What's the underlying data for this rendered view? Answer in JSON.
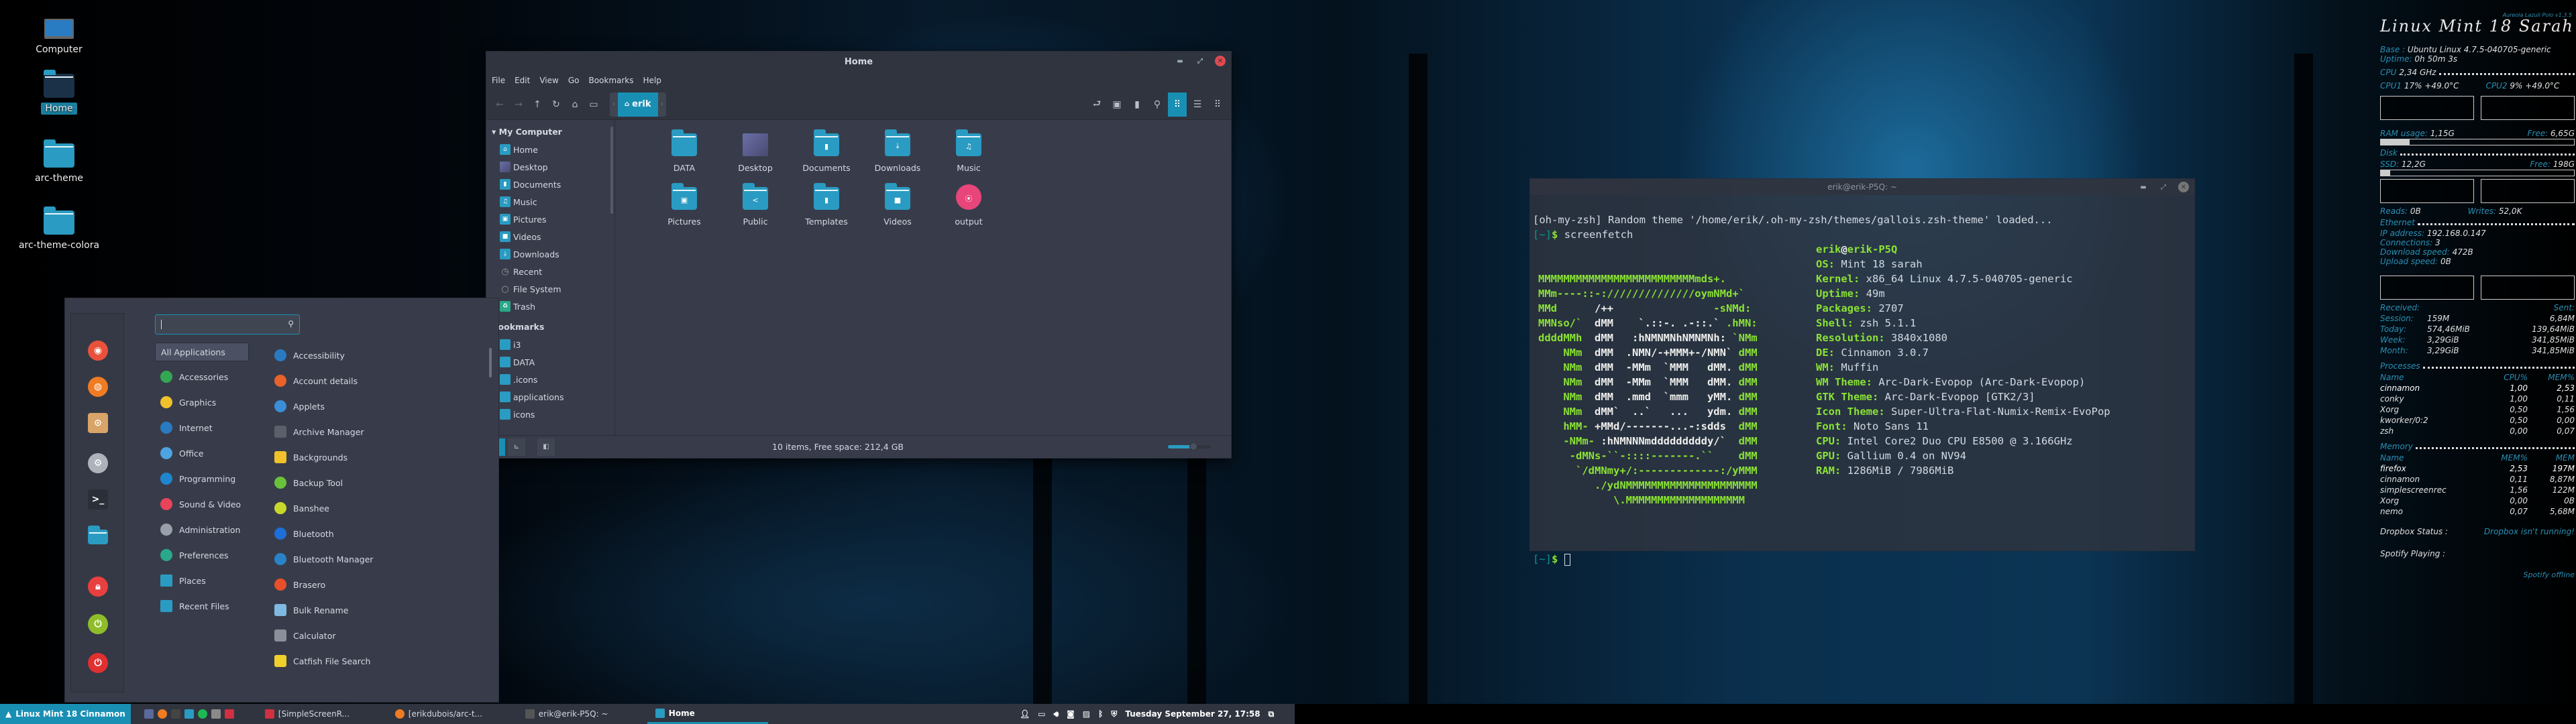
{
  "desktop": {
    "icons": [
      {
        "label": "Computer",
        "icon": "laptop-icon"
      },
      {
        "label": "Home",
        "icon": "home-folder-icon",
        "selected": true
      },
      {
        "label": "arc-theme",
        "icon": "folder-icon"
      },
      {
        "label": "arc-theme-colora",
        "icon": "folder-icon"
      }
    ]
  },
  "file_manager": {
    "title": "Home",
    "menu": [
      "File",
      "Edit",
      "View",
      "Go",
      "Bookmarks",
      "Help"
    ],
    "breadcrumb": {
      "current": "erik",
      "icon": "home-icon"
    },
    "sidebar": {
      "my_computer_header": "My Computer",
      "places": [
        {
          "label": "Home",
          "icon": "home-icon"
        },
        {
          "label": "Desktop",
          "icon": "desktop-icon"
        },
        {
          "label": "Documents",
          "icon": "document-icon"
        },
        {
          "label": "Music",
          "icon": "music-icon"
        },
        {
          "label": "Pictures",
          "icon": "picture-icon"
        },
        {
          "label": "Videos",
          "icon": "video-icon"
        },
        {
          "label": "Downloads",
          "icon": "download-icon"
        },
        {
          "label": "Recent",
          "icon": "clock-icon"
        },
        {
          "label": "File System",
          "icon": "drive-icon"
        },
        {
          "label": "Trash",
          "icon": "trash-icon"
        }
      ],
      "bookmarks_header": "Bookmarks",
      "bookmarks": [
        "i3",
        "DATA",
        ".icons",
        "applications",
        "icons"
      ]
    },
    "items": [
      {
        "label": "DATA",
        "icon": "folder-icon",
        "glyph": ""
      },
      {
        "label": "Desktop",
        "icon": "desktop-icon",
        "glyph": ""
      },
      {
        "label": "Documents",
        "icon": "document-folder-icon",
        "glyph": "▮"
      },
      {
        "label": "Downloads",
        "icon": "download-folder-icon",
        "glyph": "⤓"
      },
      {
        "label": "Music",
        "icon": "music-folder-icon",
        "glyph": "♫"
      },
      {
        "label": "Pictures",
        "icon": "picture-folder-icon",
        "glyph": "▣"
      },
      {
        "label": "Public",
        "icon": "share-folder-icon",
        "glyph": "<"
      },
      {
        "label": "Templates",
        "icon": "template-folder-icon",
        "glyph": "▮"
      },
      {
        "label": "Videos",
        "icon": "video-folder-icon",
        "glyph": "■"
      },
      {
        "label": "output",
        "icon": "film-reel-icon",
        "glyph": ""
      }
    ],
    "status": "10 items, Free space: 212,4 GB",
    "zoom_level_fraction": 0.6
  },
  "app_menu": {
    "search": {
      "value": "",
      "placeholder": ""
    },
    "favorites": [
      {
        "name": "chromium-icon",
        "color": "#e8513a"
      },
      {
        "name": "firefox-icon",
        "color": "#ef7b23"
      },
      {
        "name": "installer-icon",
        "color": "#d9a468"
      },
      {
        "name": "settings-icon",
        "color": "#aeb3bb"
      },
      {
        "name": "terminal-icon",
        "color": "#2b2f38"
      },
      {
        "name": "files-icon",
        "color": "#2a9bc2"
      },
      {
        "name": "lock-icon",
        "color": "#e84040"
      },
      {
        "name": "logout-icon",
        "color": "#8fbd2a"
      },
      {
        "name": "power-icon",
        "color": "#e03030"
      }
    ],
    "categories": [
      {
        "label": "All Applications",
        "selected": true,
        "color": ""
      },
      {
        "label": "Accessories",
        "color": "#33a853"
      },
      {
        "label": "Graphics",
        "color": "#f0c12a"
      },
      {
        "label": "Internet",
        "color": "#2a7ac2"
      },
      {
        "label": "Office",
        "color": "#4ea4e0"
      },
      {
        "label": "Programming",
        "color": "#1e86cf"
      },
      {
        "label": "Sound & Video",
        "color": "#e8435a"
      },
      {
        "label": "Administration",
        "color": "#9aa0aa"
      },
      {
        "label": "Preferences",
        "color": "#2aa88a"
      },
      {
        "label": "Places",
        "color": "#2a9bc2"
      },
      {
        "label": "Recent Files",
        "color": "#2a9bc2"
      }
    ],
    "applications": [
      {
        "label": "Accessibility",
        "color": "#2a7ac2"
      },
      {
        "label": "Account details",
        "color": "#e8622a"
      },
      {
        "label": "Applets",
        "color": "#3a8fd8"
      },
      {
        "label": "Archive Manager",
        "color": "#5a5f6a"
      },
      {
        "label": "Backgrounds",
        "color": "#f0c12a"
      },
      {
        "label": "Backup Tool",
        "color": "#6ac23a"
      },
      {
        "label": "Banshee",
        "color": "#c8d82a"
      },
      {
        "label": "Bluetooth",
        "color": "#1e6fd8"
      },
      {
        "label": "Bluetooth Manager",
        "color": "#2a82c8"
      },
      {
        "label": "Brasero",
        "color": "#e8502a"
      },
      {
        "label": "Bulk Rename",
        "color": "#7fb8e0"
      },
      {
        "label": "Calculator",
        "color": "#8a8f9a"
      },
      {
        "label": "Catfish File Search",
        "color": "#f0d02a"
      }
    ]
  },
  "terminal": {
    "title": "erik@erik-P5Q: ~",
    "theme_line": "[oh-my-zsh] Random theme '/home/erik/.oh-my-zsh/themes/gallois.zsh-theme' loaded...",
    "prompt_dir": "[~]",
    "prompt_symbol": "$",
    "command": "screenfetch",
    "ascii_art": [
      [
        "MMMMMMMMMMMMMMMMMMMMMMMMMmds+.",
        "",
        ""
      ],
      [
        "MMm----::-://////////////oymNMd+`",
        "",
        ""
      ],
      [
        "MMd      ",
        "/++",
        "                -sNMd:"
      ],
      [
        "MMNso/`  ",
        "dMM    `.::-. .-::.`",
        " .hMN:"
      ],
      [
        "ddddMMh  ",
        "dMM   :hNMNMNhNMNMNh:",
        " `NMm"
      ],
      [
        "    NMm  ",
        "dMM  .NMN/-+MMM+-/NMN`",
        " dMM"
      ],
      [
        "    NMm  ",
        "dMM  -MMm  `MMM   dMM.",
        " dMM"
      ],
      [
        "    NMm  ",
        "dMM  -MMm  `MMM   dMM.",
        " dMM"
      ],
      [
        "    NMm  ",
        "dMM  .mmd  `mmm   yMM.",
        " dMM"
      ],
      [
        "    NMm  ",
        "dMM`  ..`   ...   ydm.",
        " dMM"
      ],
      [
        "    hMM- ",
        "+MMd/-------...-:sdds",
        "  dMM"
      ],
      [
        "    -NMm- ",
        ":hNMNNNmdddddddddy/`",
        "  dMM"
      ],
      [
        "     -dMNs-``-::::-------.``",
        "",
        "    dMM"
      ],
      [
        "      `/dMNmy+/:-------------:/yMMM",
        "",
        ""
      ],
      [
        "         ./ydNMMMMMMMMMMMMMMMMMMMMM",
        "",
        ""
      ],
      [
        "            \\.MMMMMMMMMMMMMMMMMMM",
        "",
        ""
      ]
    ],
    "user": "erik",
    "host": "erik-P5Q",
    "info": [
      {
        "key": "OS:",
        "value": "Mint 18 sarah"
      },
      {
        "key": "Kernel:",
        "value": "x86_64 Linux 4.7.5-040705-generic"
      },
      {
        "key": "Uptime:",
        "value": "49m"
      },
      {
        "key": "Packages:",
        "value": "2707"
      },
      {
        "key": "Shell:",
        "value": "zsh 5.1.1"
      },
      {
        "key": "Resolution:",
        "value": "3840x1080"
      },
      {
        "key": "DE:",
        "value": "Cinnamon 3.0.7"
      },
      {
        "key": "WM:",
        "value": "Muffin"
      },
      {
        "key": "WM Theme:",
        "value": "Arc-Dark-Evopop (Arc-Dark-Evopop)"
      },
      {
        "key": "GTK Theme:",
        "value": "Arc-Dark-Evopop [GTK2/3]"
      },
      {
        "key": "Icon Theme:",
        "value": "Super-Ultra-Flat-Numix-Remix-EvoPop"
      },
      {
        "key": "Font:",
        "value": "Noto Sans 11"
      },
      {
        "key": "CPU:",
        "value": "Intel Core2 Duo CPU E8500 @ 3.166GHz"
      },
      {
        "key": "GPU:",
        "value": "Gallium 0.4 on NV94"
      },
      {
        "key": "RAM:",
        "value": "1286MiB / 7986MiB"
      }
    ]
  },
  "conky": {
    "version": "Aureola Lazuli Polo v1.3.5",
    "title": "Linux Mint 18 Sarah",
    "base_label": "Base :",
    "base_value": "Ubuntu Linux 4.7.5-040705-generic",
    "uptime_label": "Uptime:",
    "uptime_value": "0h 50m 3s",
    "cpu_label": "CPU",
    "cpu_freq": "2,34 GHz",
    "cpu1": {
      "label": "CPU1",
      "usage": "17%",
      "temp": "+49.0°C"
    },
    "cpu2": {
      "label": "CPU2",
      "usage": "9%",
      "temp": "+49.0°C"
    },
    "ram_label": "RAM usage:",
    "ram_value": "1,15G",
    "ram_free_label": "Free:",
    "ram_free": "6,65G",
    "ram_fraction": 0.15,
    "disk_label": "Disk",
    "ssd_label": "SSD:",
    "ssd_value": "12,2G",
    "ssd_free_label": "Free:",
    "ssd_free": "198G",
    "ssd_fraction": 0.05,
    "reads_label": "Reads:",
    "reads": "0B",
    "writes_label": "Writes:",
    "writes": "52,0K",
    "ethernet_label": "Ethernet",
    "ip_label": "IP address:",
    "ip": "192.168.0.147",
    "connections_label": "Connections:",
    "connections": "3",
    "download_label": "Download speed:",
    "download": "472B",
    "upload_label": "Upload speed:",
    "upload": "0B",
    "received_label": "Received:",
    "sent_label": "Sent:",
    "traffic": [
      {
        "period": "Session:",
        "received": "159M",
        "sent": "6,84M"
      },
      {
        "period": "Today:",
        "received": "574,46MiB",
        "sent": "139,64MiB"
      },
      {
        "period": "Week:",
        "received": "3,29GiB",
        "sent": "341,85MiB"
      },
      {
        "period": "Month:",
        "received": "3,29GiB",
        "sent": "341,85MiB"
      }
    ],
    "processes_label": "Processes",
    "processes_headers": [
      "Name",
      "CPU%",
      "MEM%"
    ],
    "processes": [
      {
        "name": "cinnamon",
        "cpu": "1,00",
        "mem": "2,53"
      },
      {
        "name": "conky",
        "cpu": "1,00",
        "mem": "0,11"
      },
      {
        "name": "Xorg",
        "cpu": "0,50",
        "mem": "1,56"
      },
      {
        "name": "kworker/0:2",
        "cpu": "0,50",
        "mem": "0,00"
      },
      {
        "name": "zsh",
        "cpu": "0,00",
        "mem": "0,07"
      }
    ],
    "memory_label": "Memory",
    "memory_headers": [
      "Name",
      "MEM%",
      "MEM"
    ],
    "memory": [
      {
        "name": "firefox",
        "pct": "2,53",
        "mem": "197M"
      },
      {
        "name": "cinnamon",
        "pct": "0,11",
        "mem": "8,87M"
      },
      {
        "name": "simplescreenrec",
        "pct": "1,56",
        "mem": "122M"
      },
      {
        "name": "Xorg",
        "pct": "0,00",
        "mem": "0B"
      },
      {
        "name": "nemo",
        "pct": "0,07",
        "mem": "5,68M"
      }
    ],
    "dropbox_label": "Dropbox Status :",
    "dropbox_value": "Dropbox isn't running!",
    "spotify_label": "Spotify Playing :",
    "spotify_value": "Spotify offline"
  },
  "taskbar": {
    "menu_label": "Linux Mint 18 Cinnamon",
    "launchers": [
      {
        "name": "show-desktop-icon",
        "color": "#5a6a9a"
      },
      {
        "name": "firefox-launcher-icon",
        "color": "#ef7b23"
      },
      {
        "name": "terminal-launcher-icon",
        "color": "#444"
      },
      {
        "name": "files-launcher-icon",
        "color": "#2a9bc2"
      },
      {
        "name": "spotify-launcher-icon",
        "color": "#1db954"
      },
      {
        "name": "sublime-launcher-icon",
        "color": "#8a8a8a"
      },
      {
        "name": "screenrecorder-launcher-icon",
        "color": "#d03040"
      }
    ],
    "windows": [
      {
        "label": "[SimpleScreenR...",
        "icon": "screenrecorder-icon",
        "color": "#d03040",
        "active": false
      },
      {
        "label": "[erikdubois/arc-t...",
        "icon": "firefox-icon",
        "color": "#ef7b23",
        "active": false
      },
      {
        "label": "erik@erik-P5Q: ~",
        "icon": "terminal-icon",
        "color": "#555",
        "active": false
      },
      {
        "label": "Home",
        "icon": "folder-icon",
        "color": "#2a9bc2",
        "active": true
      }
    ],
    "tray": [
      "user-icon",
      "display-icon",
      "volume-icon",
      "camera-icon",
      "image-icon",
      "bluetooth-icon",
      "shield-icon"
    ],
    "clock": "Tuesday September 27, 17:58"
  }
}
